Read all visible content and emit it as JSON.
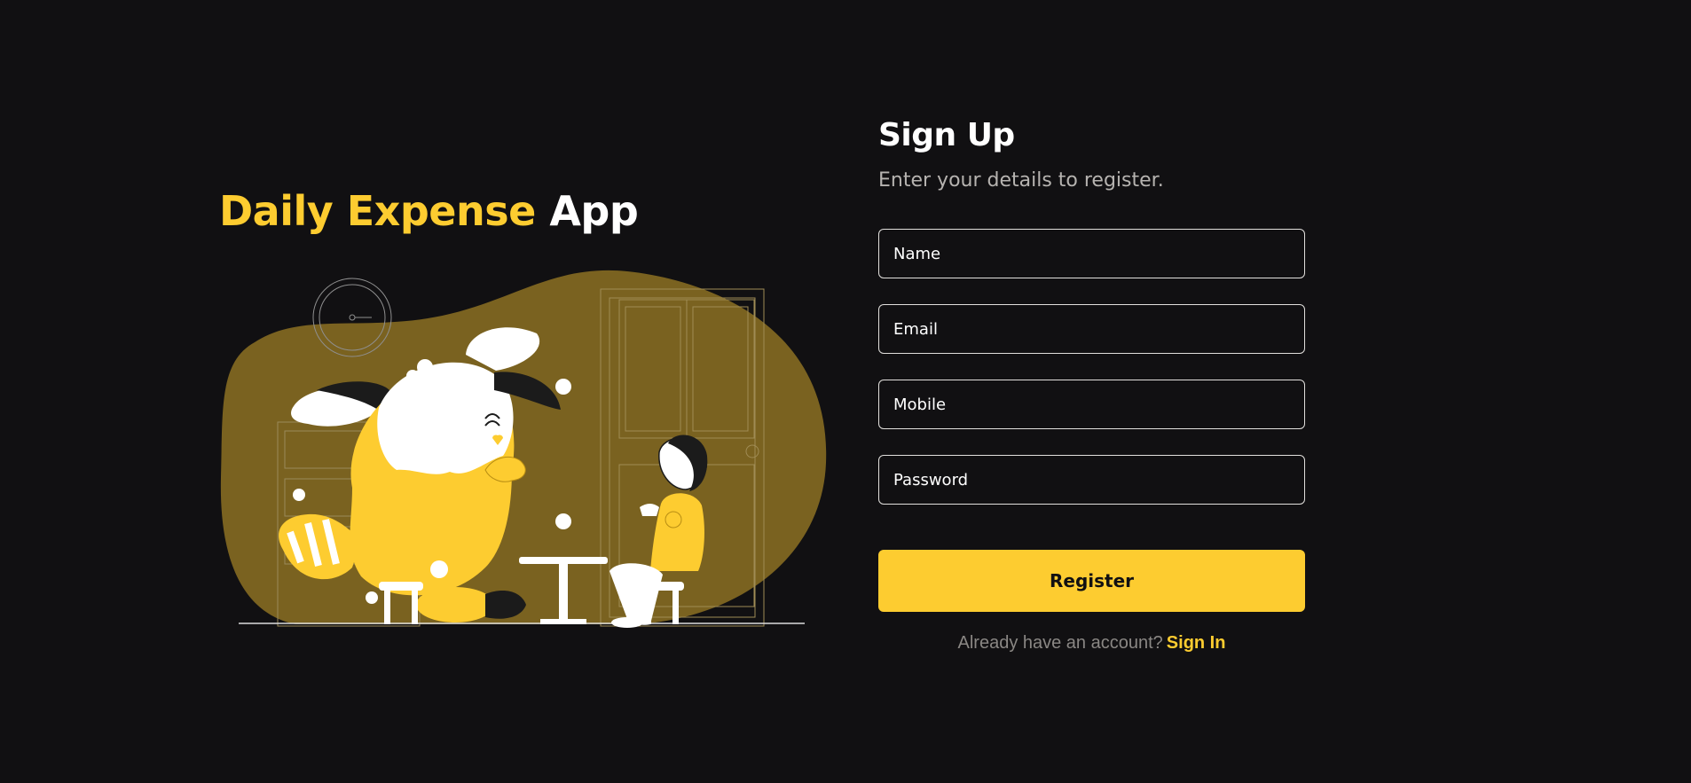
{
  "hero": {
    "title_accent": "Daily Expense",
    "title_rest": "App"
  },
  "form": {
    "title": "Sign Up",
    "subtitle": "Enter your details to register.",
    "fields": [
      {
        "placeholder": "Name",
        "value": ""
      },
      {
        "placeholder": "Email",
        "value": ""
      },
      {
        "placeholder": "Mobile",
        "value": ""
      },
      {
        "placeholder": "Password",
        "value": ""
      }
    ],
    "register_label": "Register",
    "signin_prompt": "Already have an account?",
    "signin_link": "Sign In"
  },
  "colors": {
    "background": "#111012",
    "accent": "#fdcc30",
    "blob": "#7a6220",
    "text_muted": "#b6b3b0"
  },
  "icons": [
    "wall-clock-icon",
    "door-icon",
    "creature-illustration",
    "girl-illustration",
    "table-icon"
  ]
}
